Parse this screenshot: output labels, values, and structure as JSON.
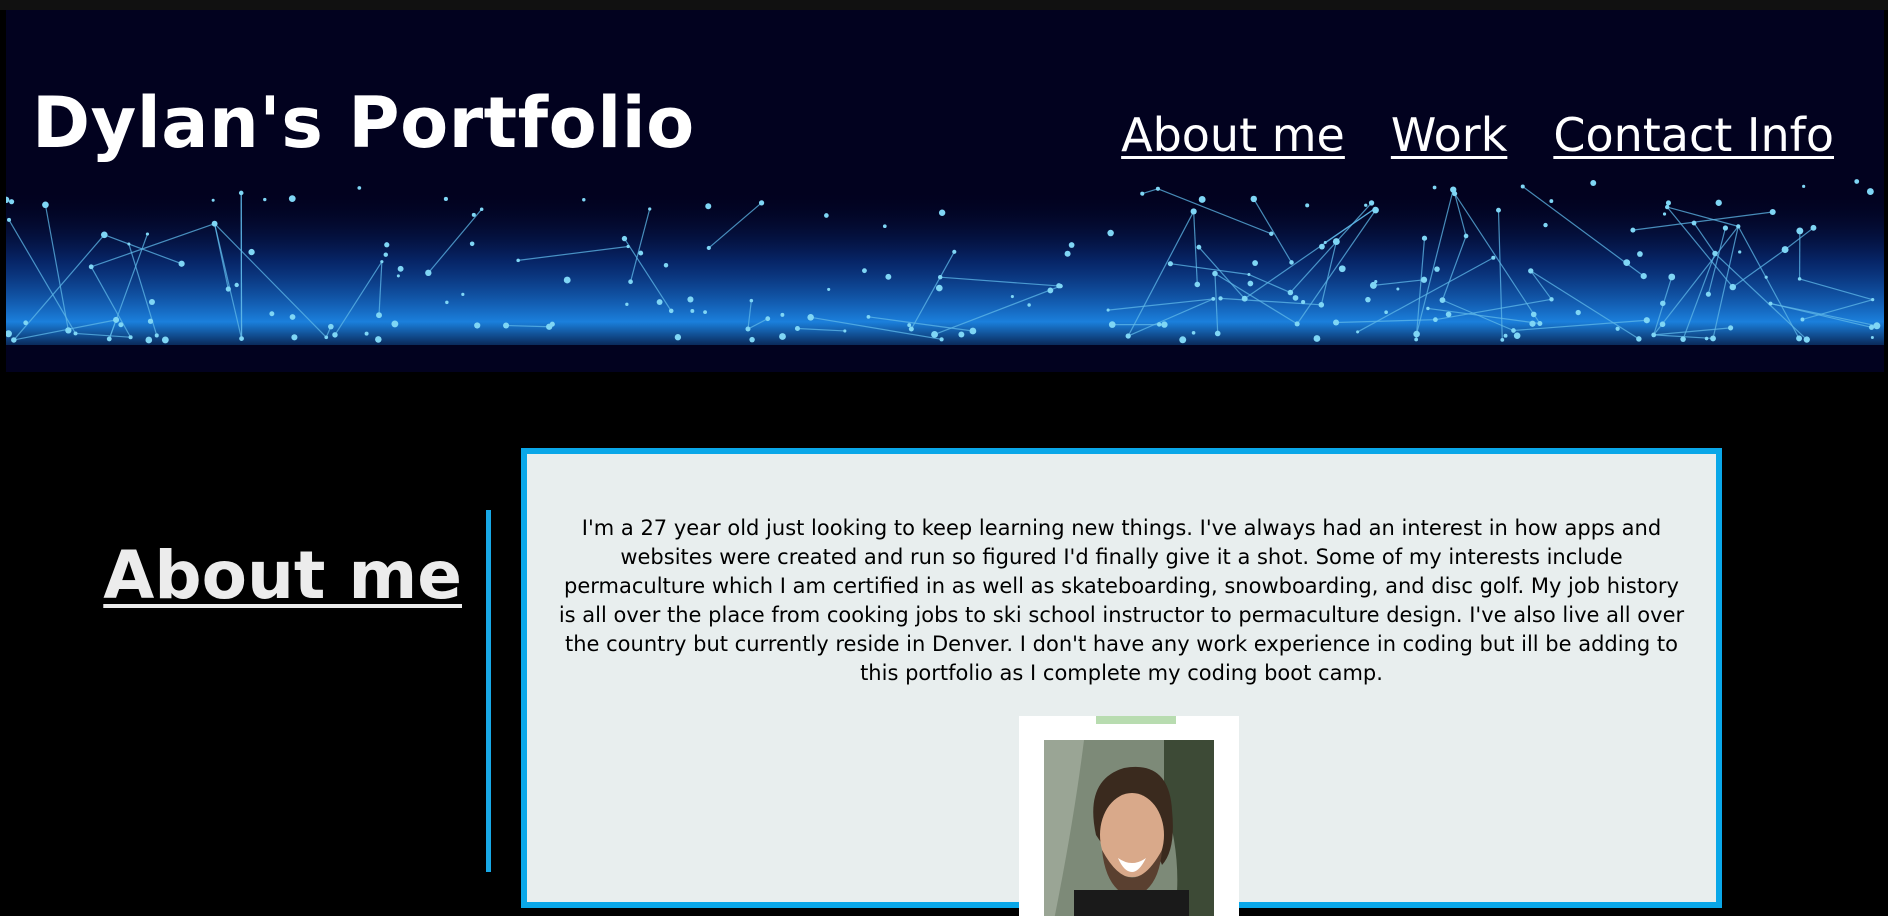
{
  "header": {
    "title": "Dylan's Portfolio",
    "nav": [
      {
        "label": "About me"
      },
      {
        "label": "Work"
      },
      {
        "label": "Contact Info"
      }
    ]
  },
  "about": {
    "heading": "About me",
    "bio": "I'm a 27 year old just looking to keep learning new things. I've always had an interest in how apps and websites were created and run so figured I'd finally give it a shot. Some of my interests include permaculture which I am certified in as well as skateboarding, snowboarding, and disc golf. My job history is all over the place from cooking jobs to ski school instructor to permaculture design. I've also live all over the country but currently reside in Denver. I don't have any work experience in coding but ill be adding to this portfolio as I complete my coding boot camp."
  },
  "colors": {
    "page_background": "#000000",
    "header_background": "#02021f",
    "network_line": "#5fb8e8",
    "network_node": "#7fd6f5",
    "accent": "#0aa7e8",
    "card_background": "#e8eeee"
  },
  "icons": {
    "profile_photo": "portrait-photo"
  }
}
